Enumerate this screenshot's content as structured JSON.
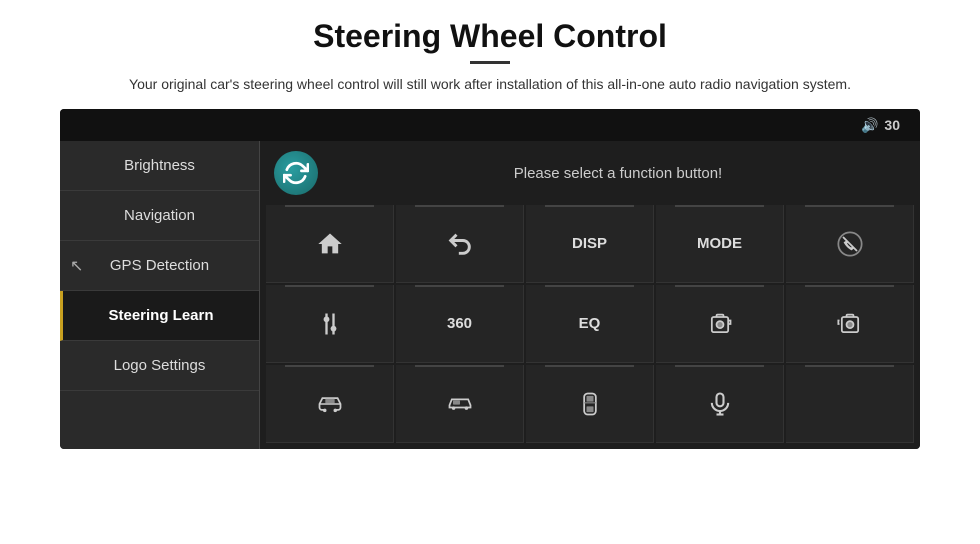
{
  "page": {
    "title": "Steering Wheel Control",
    "divider": true,
    "subtitle": "Your original car's steering wheel control will still work after installation of this all-in-one auto radio navigation system."
  },
  "topbar": {
    "volume_icon": "🔊",
    "volume_level": "30"
  },
  "sidebar": {
    "items": [
      {
        "id": "brightness",
        "label": "Brightness",
        "active": false
      },
      {
        "id": "navigation",
        "label": "Navigation",
        "active": false
      },
      {
        "id": "gps-detection",
        "label": "GPS Detection",
        "active": false
      },
      {
        "id": "steering-learn",
        "label": "Steering Learn",
        "active": true
      },
      {
        "id": "logo-settings",
        "label": "Logo Settings",
        "active": false
      }
    ]
  },
  "content": {
    "prompt": "Please select a function button!"
  },
  "buttons": [
    {
      "id": "home",
      "type": "icon",
      "icon": "home"
    },
    {
      "id": "back",
      "type": "icon",
      "icon": "back"
    },
    {
      "id": "disp",
      "type": "label",
      "label": "DISP"
    },
    {
      "id": "mode",
      "type": "label",
      "label": "MODE"
    },
    {
      "id": "phone-off",
      "type": "icon",
      "icon": "phone-off"
    },
    {
      "id": "tune",
      "type": "icon",
      "icon": "tune"
    },
    {
      "id": "360",
      "type": "label",
      "label": "360"
    },
    {
      "id": "eq",
      "type": "label",
      "label": "EQ"
    },
    {
      "id": "camera1",
      "type": "icon",
      "icon": "camera"
    },
    {
      "id": "camera2",
      "type": "icon",
      "icon": "camera-alt"
    },
    {
      "id": "car1",
      "type": "icon",
      "icon": "car-front"
    },
    {
      "id": "car2",
      "type": "icon",
      "icon": "car-side"
    },
    {
      "id": "car3",
      "type": "icon",
      "icon": "car-top"
    },
    {
      "id": "mic",
      "type": "icon",
      "icon": "mic"
    },
    {
      "id": "empty",
      "type": "empty",
      "label": ""
    }
  ]
}
